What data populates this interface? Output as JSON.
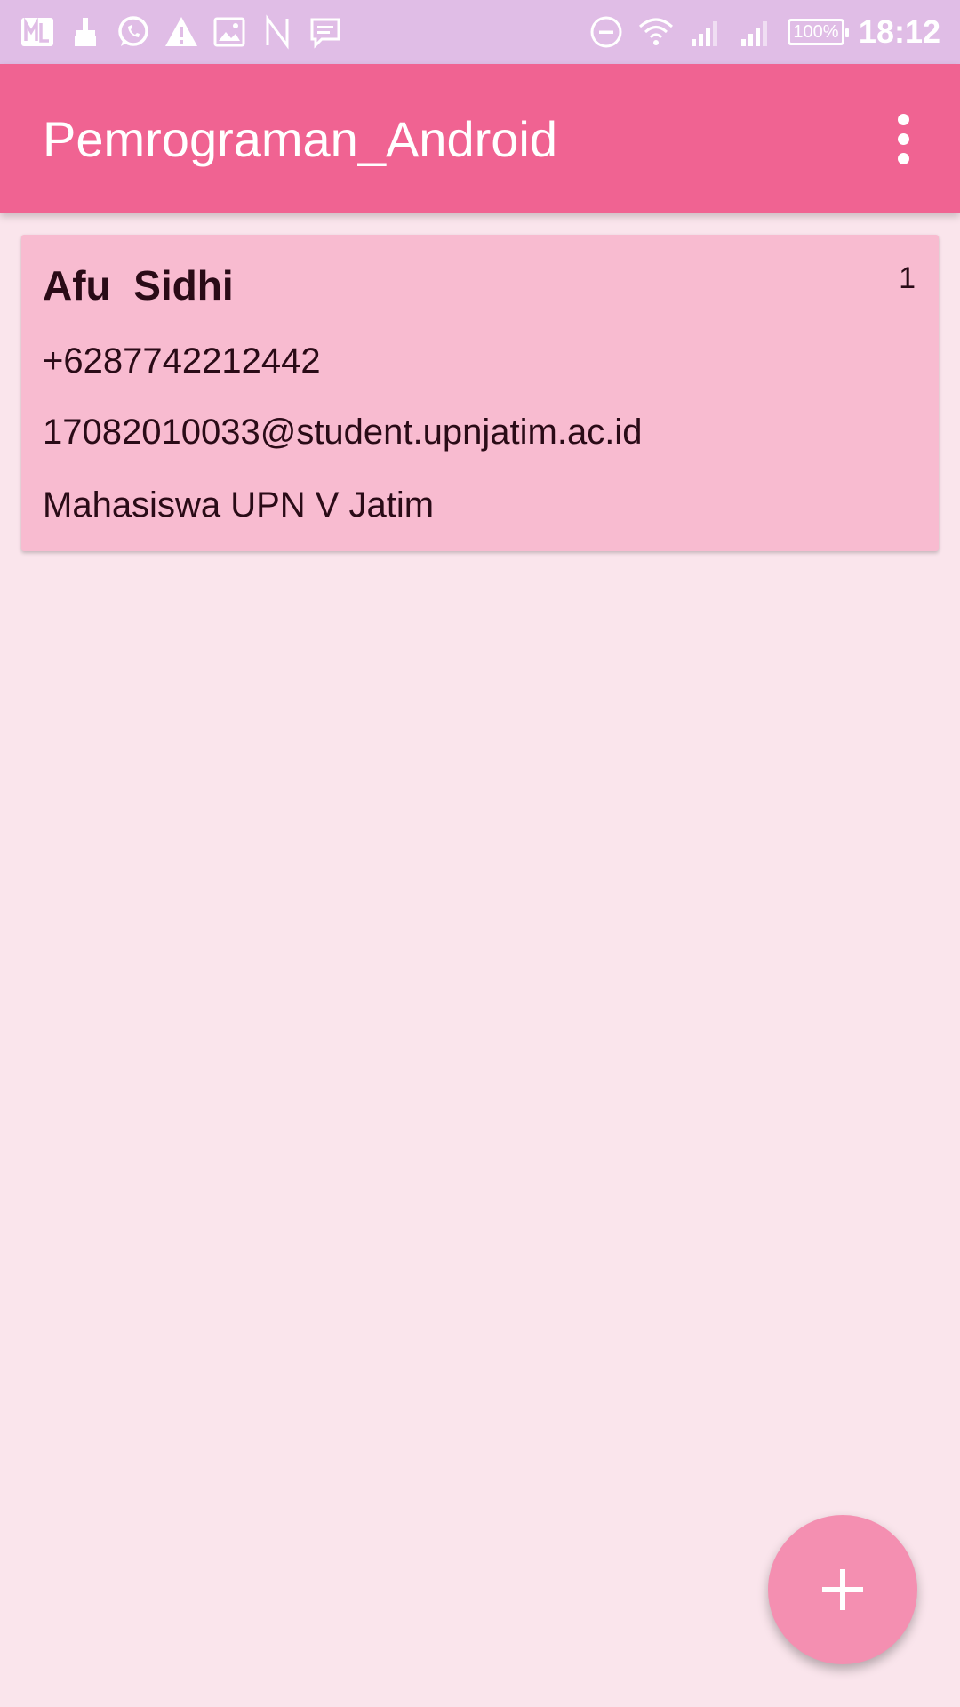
{
  "status_bar": {
    "left_icons": [
      "ml-app-icon",
      "broom-icon",
      "whatsapp-icon",
      "warning-icon",
      "image-icon",
      "n-icon",
      "message-icon"
    ],
    "right_icons": [
      "dnd-icon",
      "wifi-icon",
      "signal-icon",
      "signal-icon"
    ],
    "battery": "100%",
    "time": "18:12"
  },
  "app_bar": {
    "title": "Pemrograman_Android",
    "menu_icon": "more-vert-icon"
  },
  "contact_card": {
    "name": "Afu  Sidhi",
    "id": "1",
    "phone": "+6287742212442",
    "email": "17082010033@student.upnjatim.ac.id",
    "note": "Mahasiswa UPN V Jatim"
  },
  "fab": {
    "icon": "add-icon"
  },
  "colors": {
    "status_bar": "#e0bde6",
    "app_bar": "#f06392",
    "background": "#fae5ec",
    "card": "#f8bbd0",
    "fab": "#f48fb1",
    "text_dark": "#2a0b17"
  }
}
